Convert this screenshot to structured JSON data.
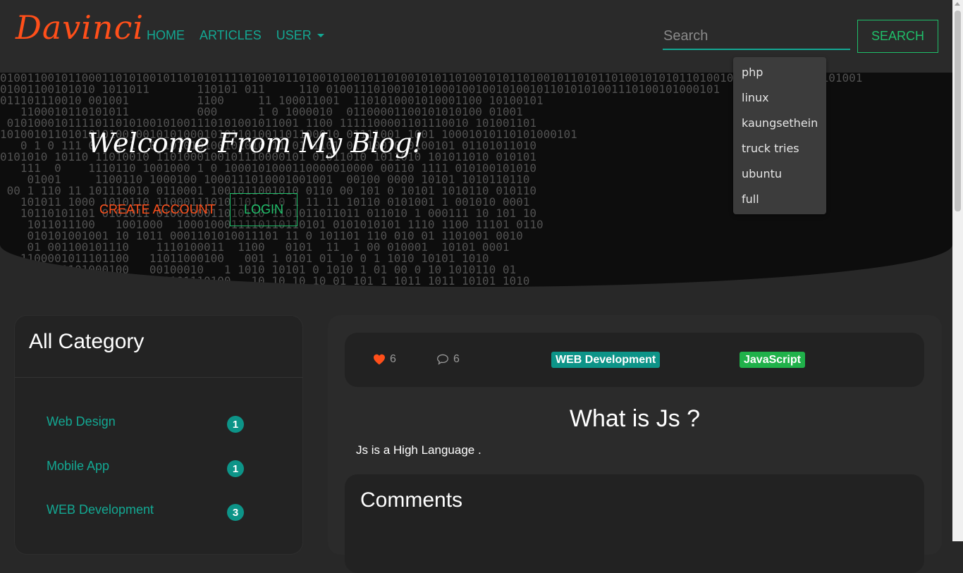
{
  "brand": "Davinci",
  "nav": {
    "home": "HOME",
    "articles": "ARTICLES",
    "user": "USER"
  },
  "search": {
    "placeholder": "Search",
    "button": "SEARCH",
    "suggestions": [
      "php",
      "linux",
      "kaungsethein",
      "truck tries",
      "ubuntu",
      "full"
    ]
  },
  "hero": {
    "title": "Welcome From My Blog!",
    "create_account": "CREATE ACCOUNT",
    "login": "LOGIN"
  },
  "sidebar": {
    "title": "All Category",
    "items": [
      {
        "label": "Web Design",
        "count": "1"
      },
      {
        "label": "Mobile App",
        "count": "1"
      },
      {
        "label": "WEB Development",
        "count": "3"
      }
    ]
  },
  "post": {
    "likes": "6",
    "comments": "6",
    "tags": [
      "WEB Development",
      "JavaScript"
    ],
    "title": "What is Js ?",
    "body": "Js is a High Language ."
  },
  "comments": {
    "title": "Comments"
  },
  "colors": {
    "brand": "#ff4f1a",
    "accent": "#13a893",
    "green": "#1fbf6a",
    "badge": "#0d9488"
  }
}
